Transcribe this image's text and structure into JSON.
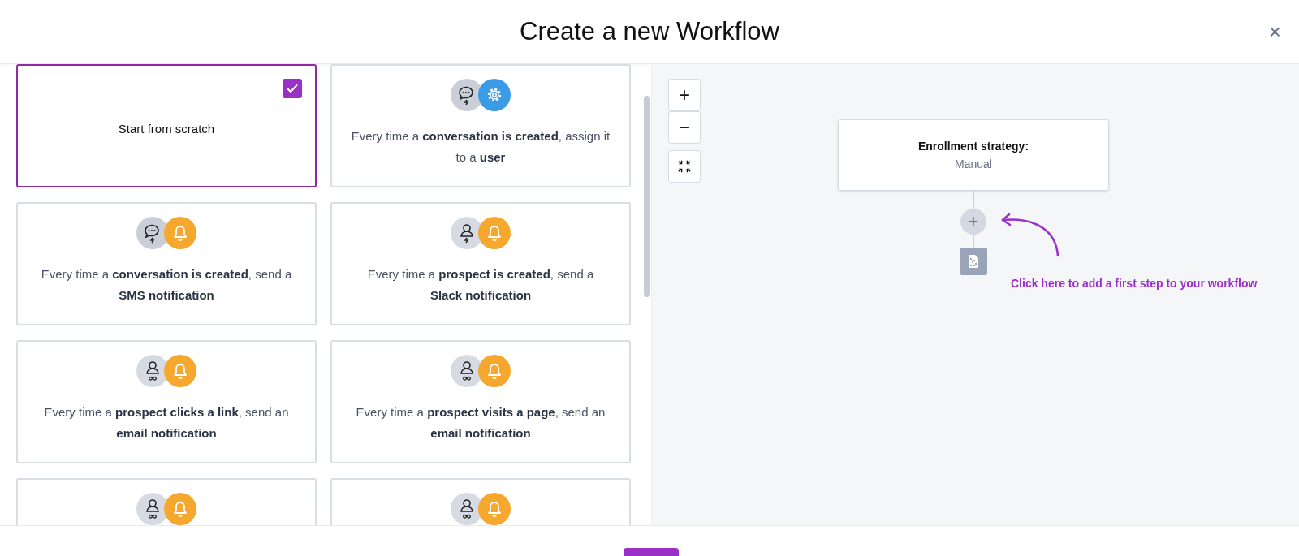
{
  "dialog": {
    "title": "Create a new Workflow",
    "close": "×"
  },
  "templates": [
    {
      "kind": "blank",
      "selected": true,
      "label": "Start from scratch"
    },
    {
      "kind": "template",
      "selected": false,
      "icons": [
        {
          "kind": "conversation"
        },
        {
          "kind": "gear"
        }
      ],
      "description": "Every time a **conversation is created**, assign it to a **user**"
    },
    {
      "kind": "template",
      "selected": false,
      "icons": [
        {
          "kind": "conversation"
        },
        {
          "kind": "bell"
        }
      ],
      "description": "Every time a **conversation is created**, send a **SMS notification**"
    },
    {
      "kind": "template",
      "selected": false,
      "icons": [
        {
          "kind": "prospect"
        },
        {
          "kind": "bell"
        }
      ],
      "description": "Every time a **prospect is created**, send a **Slack notification**"
    },
    {
      "kind": "template",
      "selected": false,
      "icons": [
        {
          "kind": "link"
        },
        {
          "kind": "bell"
        }
      ],
      "description": "Every time a **prospect clicks a link**, send an **email notification**"
    },
    {
      "kind": "template",
      "selected": false,
      "icons": [
        {
          "kind": "link"
        },
        {
          "kind": "bell"
        }
      ],
      "description": "Every time a **prospect visits a page**, send an **email notification**"
    },
    {
      "kind": "template",
      "selected": false,
      "icons": [
        {
          "kind": "link"
        },
        {
          "kind": "bell"
        }
      ]
    },
    {
      "kind": "template",
      "selected": false,
      "icons": [
        {
          "kind": "link"
        },
        {
          "kind": "bell"
        }
      ]
    }
  ],
  "canvas": {
    "zoom_in": "+",
    "zoom_out": "−",
    "node": {
      "title": "Enrollment strategy:",
      "value": "Manual"
    },
    "add_step": "+",
    "hint": "Click here to add a first step to your workflow"
  }
}
